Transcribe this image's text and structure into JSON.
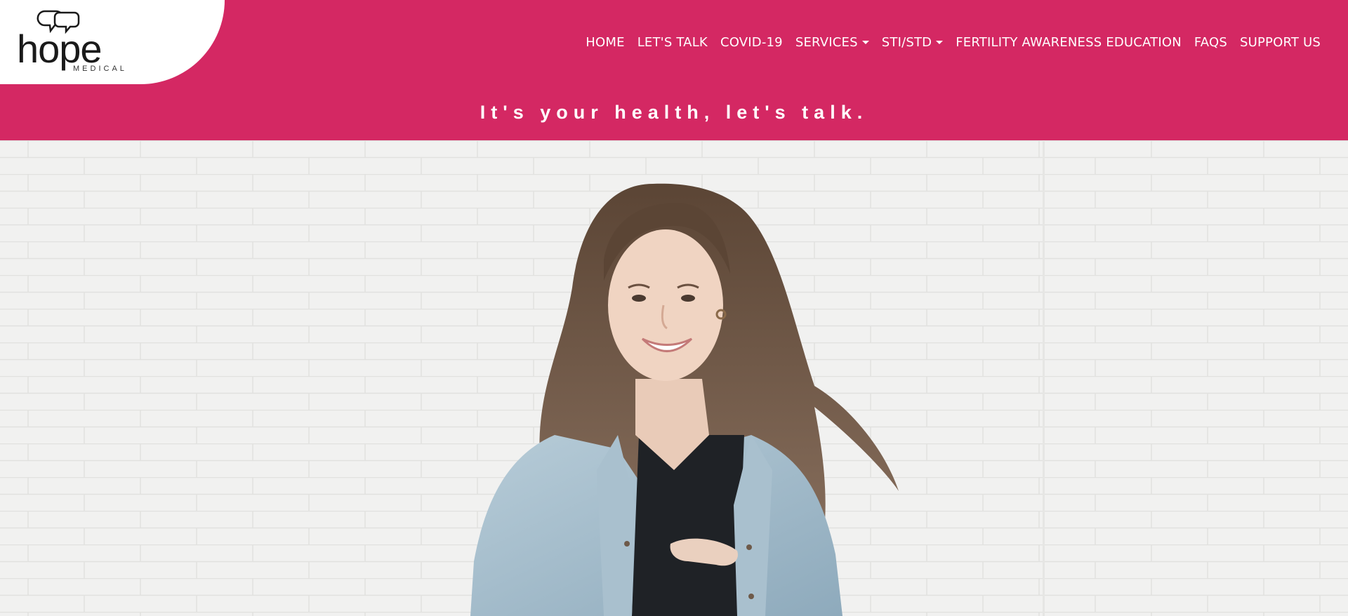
{
  "brand": {
    "logo_word": "hope",
    "logo_sub": "MEDICAL",
    "color": "#d42863"
  },
  "nav": {
    "items": [
      {
        "label": "HOME"
      },
      {
        "label": "LET'S TALK"
      },
      {
        "label": "COVID-19"
      },
      {
        "label": "SERVICES"
      },
      {
        "label": "STI/STD"
      },
      {
        "label": "FERTILITY AWARENESS EDUCATION"
      },
      {
        "label": "FAQS"
      },
      {
        "label": "SUPPORT US"
      }
    ]
  },
  "tagline": "It's your health, let's talk.",
  "hero": {
    "image": "smiling-woman-brick-wall-photo"
  }
}
